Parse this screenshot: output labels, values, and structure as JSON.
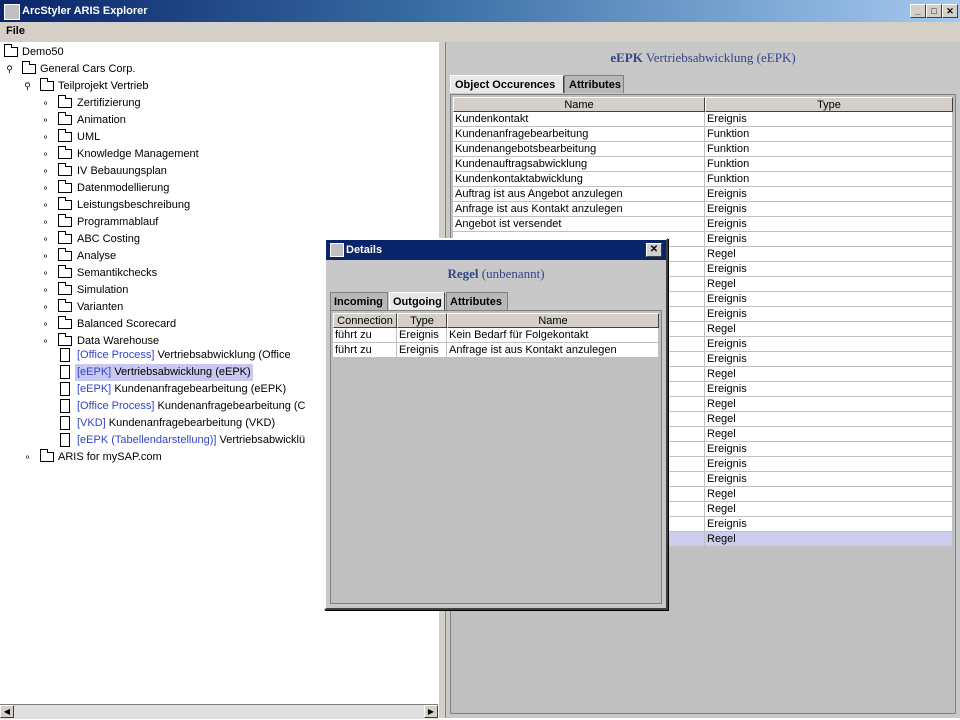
{
  "window": {
    "title": "ArcStyler ARIS Explorer",
    "minimize_glyph": "_",
    "maximize_glyph": "□",
    "close_glyph": "✕"
  },
  "menu": {
    "file": "File"
  },
  "tree": {
    "root": "Demo50",
    "company": "General Cars Corp.",
    "project": "Teilprojekt Vertrieb",
    "folders": [
      "Zertifizierung",
      "Animation",
      "UML",
      "Knowledge Management",
      "IV Bebauungsplan",
      "Datenmodellierung",
      "Leistungsbeschreibung",
      "Programmablauf",
      "ABC Costing",
      "Analyse",
      "Semantikchecks",
      "Simulation",
      "Varianten",
      "Balanced Scorecard",
      "Data Warehouse"
    ],
    "models": [
      {
        "type": "[Office Process]",
        "name": "Vertriebsabwicklung (Office"
      },
      {
        "type": "[eEPK]",
        "name": "Vertriebsabwicklung (eEPK)"
      },
      {
        "type": "[eEPK]",
        "name": "Kundenanfragebearbeitung (eEPK)"
      },
      {
        "type": "[Office Process]",
        "name": "Kundenanfragebearbeitung (C"
      },
      {
        "type": "[VKD]",
        "name": "Kundenanfragebearbeitung (VKD)"
      },
      {
        "type": "[eEPK (Tabellendarstellung)]",
        "name": "Vertriebsabwicklü"
      }
    ],
    "other": "ARIS for mySAP.com"
  },
  "right_panel": {
    "header_kw": "eEPK",
    "header_rest": " Vertriebsabwicklung (eEPK)",
    "tabs": [
      "Object Occurences",
      "Attributes"
    ],
    "columns": [
      "Name",
      "Type"
    ],
    "rows": [
      [
        "Kundenkontakt",
        "Ereignis"
      ],
      [
        "Kundenanfragebearbeitung",
        "Funktion"
      ],
      [
        "Kundenangebotsbearbeitung",
        "Funktion"
      ],
      [
        "Kundenauftragsabwicklung",
        "Funktion"
      ],
      [
        "Kundenkontaktabwicklung",
        "Funktion"
      ],
      [
        "Auftrag ist aus Angebot anzulegen",
        "Ereignis"
      ],
      [
        "Anfrage ist aus Kontakt anzulegen",
        "Ereignis"
      ],
      [
        "Angebot ist versendet",
        "Ereignis"
      ],
      [
        "",
        "Ereignis"
      ],
      [
        "",
        "Regel"
      ],
      [
        "",
        "Ereignis"
      ],
      [
        "",
        "Regel"
      ],
      [
        "",
        "Ereignis"
      ],
      [
        "",
        "Ereignis"
      ],
      [
        "",
        "Regel"
      ],
      [
        "",
        "Ereignis"
      ],
      [
        "",
        "Ereignis"
      ],
      [
        "",
        "Regel"
      ],
      [
        "",
        "Ereignis"
      ],
      [
        "",
        "Regel"
      ],
      [
        "",
        "Regel"
      ],
      [
        "",
        "Regel"
      ],
      [
        "",
        "Ereignis"
      ],
      [
        "",
        "Ereignis"
      ],
      [
        "",
        "Ereignis"
      ],
      [
        "",
        "Regel"
      ],
      [
        "",
        "Regel"
      ],
      [
        "",
        "Ereignis"
      ],
      [
        "",
        "Regel"
      ]
    ]
  },
  "dialog": {
    "title": "Details",
    "close_glyph": "✕",
    "header_kw": "Regel",
    "header_rest": " (unbenannt)",
    "tabs": [
      "Incoming",
      "Outgoing",
      "Attributes"
    ],
    "columns": [
      "Connection",
      "Type",
      "Name"
    ],
    "rows": [
      [
        "führt zu",
        "Ereignis",
        "Kein Bedarf für Folgekontakt"
      ],
      [
        "führt zu",
        "Ereignis",
        "Anfrage ist aus Kontakt anzulegen"
      ]
    ]
  }
}
